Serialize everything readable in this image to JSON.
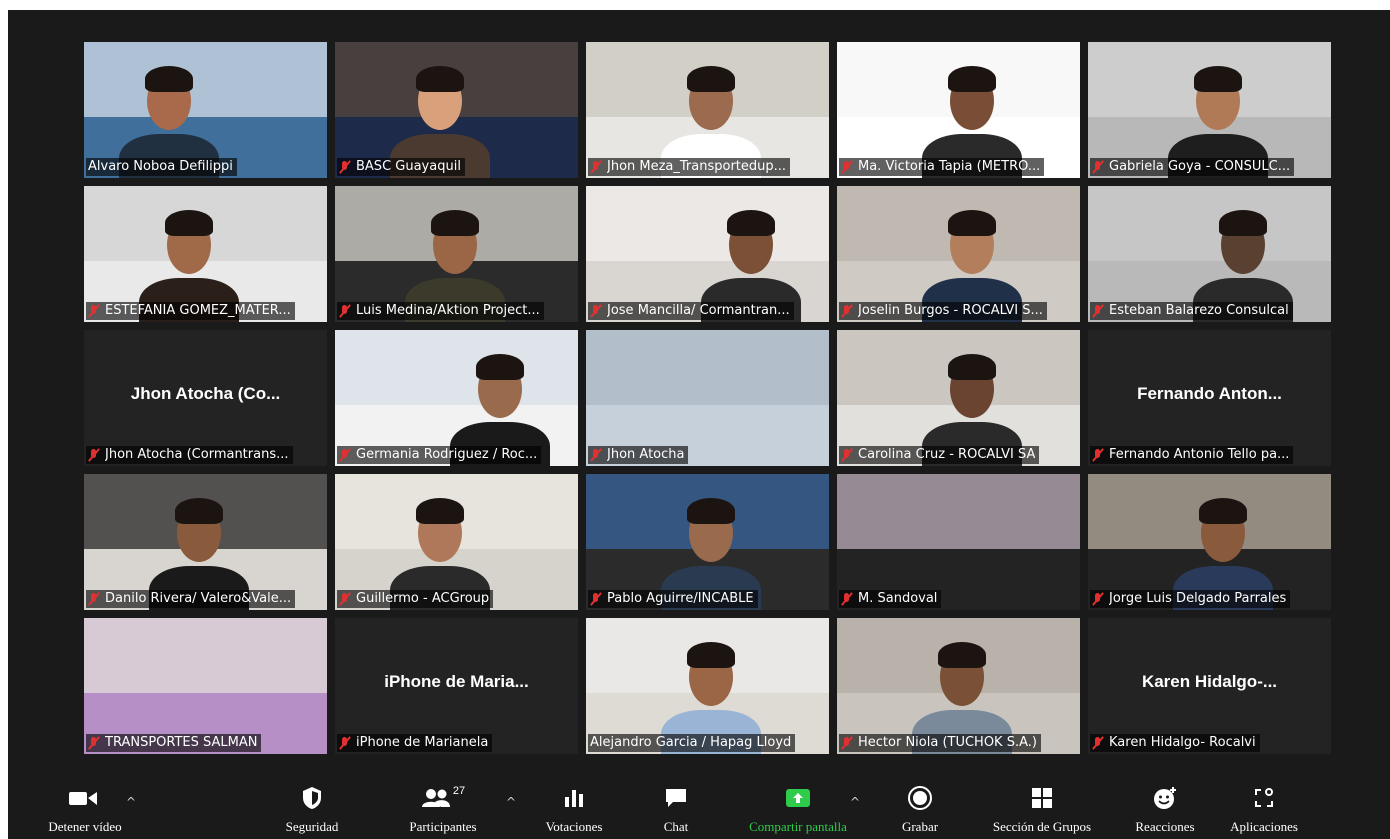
{
  "participants": [
    {
      "label": "Alvaro Noboa Defilippi",
      "muted": false,
      "speaking": true,
      "video": true
    },
    {
      "label": "BASC Guayaquil",
      "muted": true,
      "video": true
    },
    {
      "label": "Jhon Meza_Transportedup...",
      "muted": true,
      "video": true
    },
    {
      "label": "Ma. Victoria Tapia (METRO...",
      "muted": true,
      "video": true
    },
    {
      "label": "Gabriela Goya - CONSULC...",
      "muted": true,
      "video": true
    },
    {
      "label": "ESTEFANIA GOMEZ_MATER...",
      "muted": true,
      "video": true
    },
    {
      "label": "Luis Medina/Aktion Project...",
      "muted": true,
      "video": true
    },
    {
      "label": "Jose Mancilla/ Cormantran...",
      "muted": true,
      "video": true
    },
    {
      "label": "Joselin Burgos - ROCALVI S...",
      "muted": true,
      "video": true
    },
    {
      "label": "Esteban Balarezo Consulcal",
      "muted": true,
      "video": true
    },
    {
      "label": "Jhon Atocha (Cormantrans...",
      "muted": true,
      "video": false,
      "center_name": "Jhon Atocha (Co..."
    },
    {
      "label": "Germania Rodriguez / Roc...",
      "muted": true,
      "video": true
    },
    {
      "label": "Jhon Atocha",
      "muted": true,
      "video": true
    },
    {
      "label": "Carolina Cruz - ROCALVI SA",
      "muted": true,
      "video": true
    },
    {
      "label": "Fernando Antonio Tello pa...",
      "muted": true,
      "video": false,
      "center_name": "Fernando Anton..."
    },
    {
      "label": "Danilo Rivera/ Valero&Vale...",
      "muted": true,
      "video": true
    },
    {
      "label": "Guillermo - ACGroup",
      "muted": true,
      "video": true
    },
    {
      "label": "Pablo Aguirre/INCABLE",
      "muted": true,
      "video": true
    },
    {
      "label": "M. Sandoval",
      "muted": true,
      "video": true
    },
    {
      "label": "Jorge Luis Delgado Parrales",
      "muted": true,
      "video": true
    },
    {
      "label": "TRANSPORTES SALMAN",
      "muted": true,
      "video": true
    },
    {
      "label": "iPhone de Marianela",
      "muted": true,
      "video": false,
      "center_name": "iPhone de Maria..."
    },
    {
      "label": "Alejandro Garcia / Hapag Lloyd",
      "muted": false,
      "video": true
    },
    {
      "label": "Hector Niola (TUCHOK S.A.)",
      "muted": true,
      "video": true
    },
    {
      "label": "Karen Hidalgo- Rocalvi",
      "muted": true,
      "video": false,
      "center_name": "Karen Hidalgo-..."
    }
  ],
  "toolbar": {
    "stop_video": "Detener vídeo",
    "security": "Seguridad",
    "participants": "Participantes",
    "participants_count": "27",
    "polls": "Votaciones",
    "chat": "Chat",
    "share_screen": "Compartir pantalla",
    "record": "Grabar",
    "breakout": "Sección de Grupos",
    "reactions": "Reacciones",
    "apps": "Aplicaciones"
  },
  "colors": {
    "background": "#1a1a1a",
    "tile": "#232323",
    "active_speaker": "#d6e84a",
    "muted_icon": "#e03131",
    "share_green": "#2ecc4a"
  }
}
